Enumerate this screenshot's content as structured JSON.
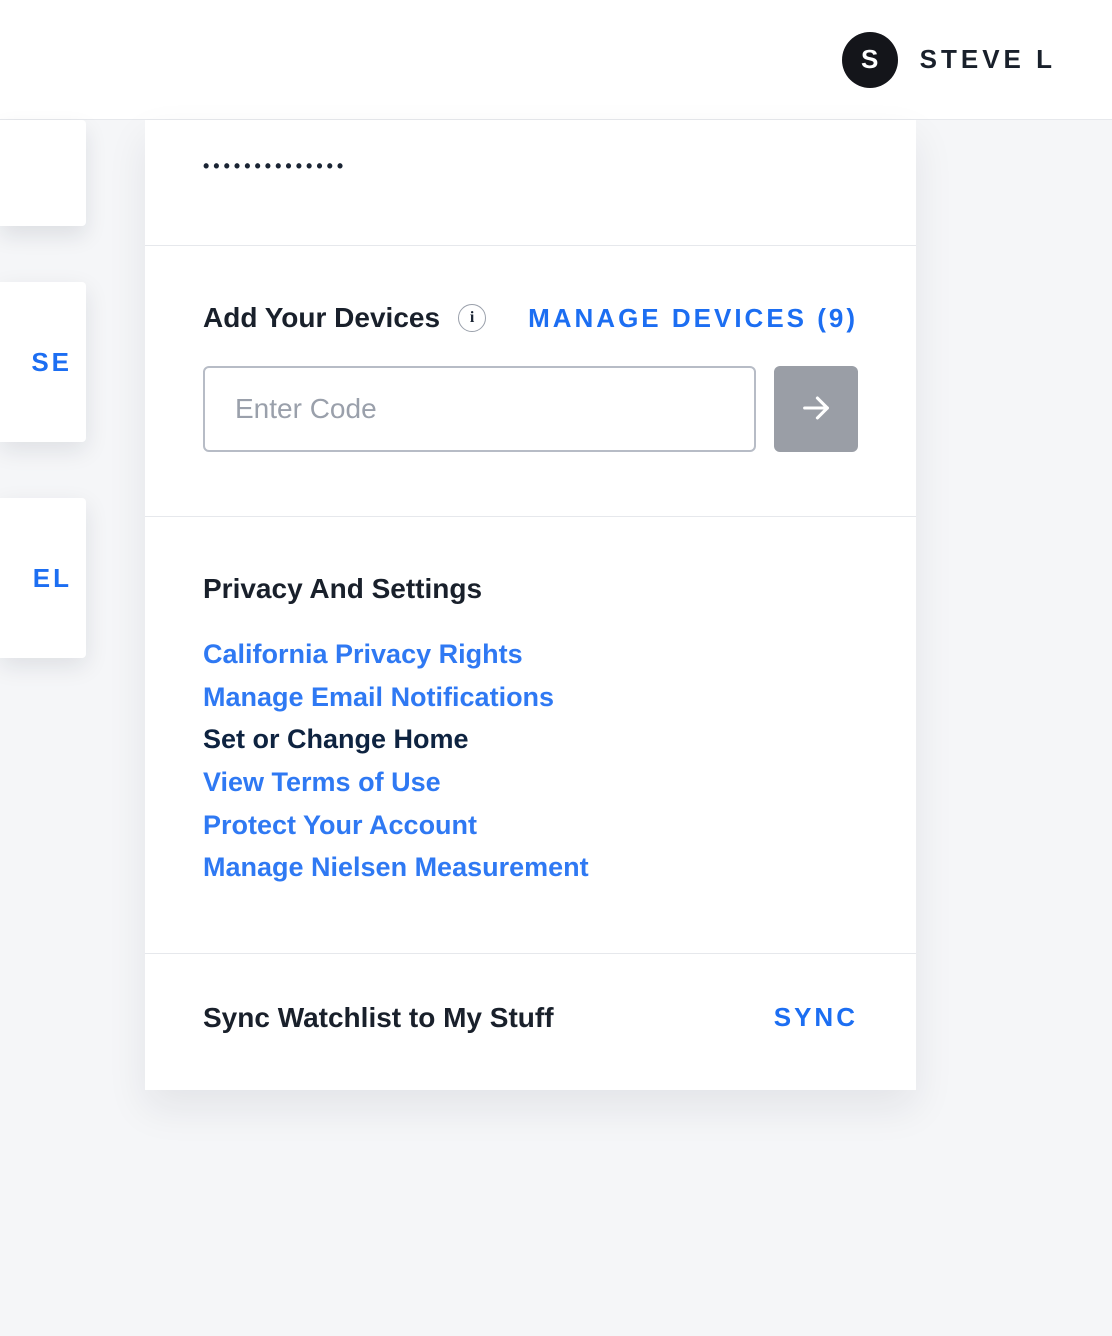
{
  "header": {
    "avatar_initial": "S",
    "username": "STEVE L"
  },
  "left_peek": {
    "frag_b": "SE",
    "frag_c": "EL"
  },
  "password_section": {
    "masked": "••••••••••••••"
  },
  "devices": {
    "title": "Add Your Devices",
    "info_glyph": "i",
    "manage_label": "MANAGE DEVICES (9)",
    "input_placeholder": "Enter Code"
  },
  "privacy": {
    "title": "Privacy And Settings",
    "links": [
      {
        "label": "California Privacy Rights",
        "style": "blue"
      },
      {
        "label": "Manage Email Notifications",
        "style": "blue"
      },
      {
        "label": "Set or Change Home",
        "style": "dark"
      },
      {
        "label": "View Terms of Use",
        "style": "blue"
      },
      {
        "label": "Protect Your Account",
        "style": "blue"
      },
      {
        "label": "Manage Nielsen Measurement",
        "style": "blue"
      }
    ]
  },
  "sync": {
    "title": "Sync Watchlist to My Stuff",
    "action": "SYNC"
  }
}
